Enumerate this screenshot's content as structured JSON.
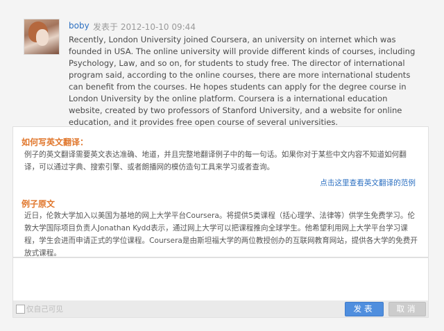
{
  "post": {
    "author": "boby",
    "meta": "发表于 2012-10-10 09:44",
    "body": "Recently, London University joined Coursera, an university on internet which was founded in USA. The online university will provide different kinds of courses, including Psychology, Law, and so on, for students to study free. The director of international program said, according to the online courses, there are more international students can benefit from the courses. He hopes students can apply for the degree course in London University by the online platform. Coursera is a international education website, created by two professors of Stanford University, and a website for online education, and it provides free open course of several universities."
  },
  "guide": {
    "heading": "如何写英文翻译：",
    "text": "例子的英文翻译需要英文表达准确、地道，并且完整地翻译例子中的每一句话。如果你对于某些中文内容不知道如何翻译，可以通过字典、搜索引擎、或者朗播网的模仿造句工具来学习或者查询。",
    "link": "点击这里查看英文翻译的范例",
    "example_heading": "例子原文",
    "example_text": "近日，伦敦大学加入以美国为基地的网上大学平台Coursera。将提供5类课程（括心理学、法律等）供学生免费学习。伦敦大学国际项目负责人Jonathan Kydd表示，通过网上大学可以把课程推向全球学生。他希望利用网上大学平台学习课程，学生会进而申请正式的学位课程。Coursera是由斯坦福大学的两位教授创办的互联网教育网站，提供各大学的免费开放式课程。"
  },
  "editor": {
    "value": ""
  },
  "toolbar": {
    "self_visible_label": "仅自己可见",
    "post_button": "发表",
    "cancel_button": "取消"
  }
}
